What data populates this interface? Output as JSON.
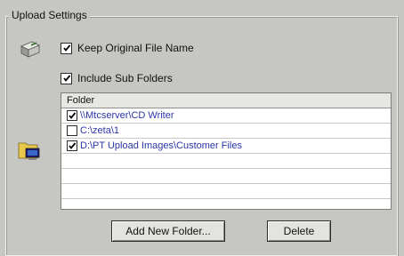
{
  "group": {
    "title": "Upload Settings"
  },
  "options": {
    "keep_original": {
      "label": "Keep Original File Name",
      "checked": true
    },
    "include_sub": {
      "label": "Include Sub Folders",
      "checked": true
    }
  },
  "folders": {
    "header": "Folder",
    "rows": [
      {
        "path": "\\\\Mtcserver\\CD Writer",
        "checked": true
      },
      {
        "path": "C:\\zeta\\1",
        "checked": false
      },
      {
        "path": "D:\\PT Upload Images\\Customer Files",
        "checked": true
      }
    ]
  },
  "buttons": {
    "add": "Add New Folder...",
    "delete": "Delete"
  },
  "icons": {
    "top": "drive-icon",
    "folder": "folder-monitor-icon"
  }
}
